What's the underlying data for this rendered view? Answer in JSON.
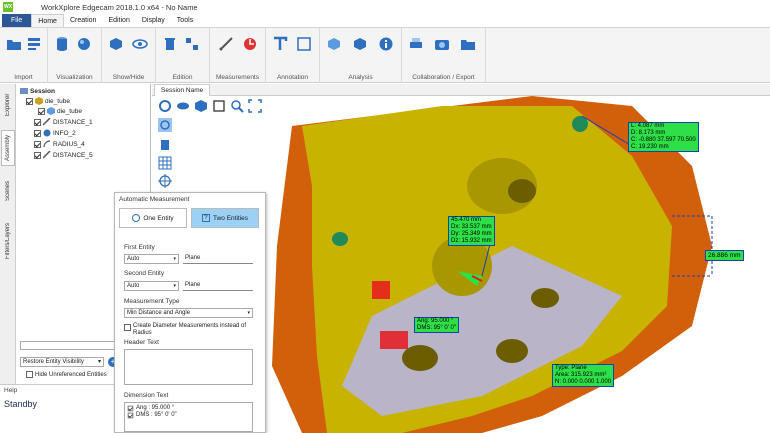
{
  "app": {
    "title": "WorkXplore Edgecam 2018.1.0 x64 - No Name",
    "logo_text": "WX"
  },
  "menu": {
    "items": [
      "File",
      "Home",
      "Creation",
      "Edition",
      "Display",
      "Tools"
    ]
  },
  "ribbon": {
    "groups": [
      "Import",
      "Visualization",
      "Show/Hide",
      "Edition",
      "Measurements",
      "Annotation",
      "Analysis",
      "Collaboration / Export"
    ]
  },
  "side_tabs": [
    "Explorer",
    "Assembly",
    "Scenes",
    "Filters/Layers"
  ],
  "tree": {
    "root": "Session",
    "items": [
      "die_tube",
      "die_tube",
      "DISTANCE_1",
      "INFO_2",
      "RADIUS_4",
      "DISTANCE_5"
    ]
  },
  "tree_footer": {
    "visibility_select": "Restore Entity Visibility",
    "hide_label": "Hide Unreferenced Entities"
  },
  "help": {
    "label": "Help",
    "status": "Standby"
  },
  "viewport": {
    "tab": "Session Name"
  },
  "measurements": {
    "box1": [
      "L: 4.087 mm",
      "D: 8.173 mm",
      "C: -0.880 37.597 70.500",
      "C: 19.230 mm"
    ],
    "box2": [
      "45.470 mm",
      "Dx: 33.537 mm",
      "Dy: 25.349 mm",
      "Dz: 15.932 mm"
    ],
    "box3": "26.886 mm",
    "box4": [
      "Ang: 95.000 °",
      "DMS: 95° 0' 0\""
    ],
    "box5": [
      "Type: Plane",
      "Area: 315.923 mm²",
      "N: 0.000 0.000 1.000"
    ]
  },
  "dialog": {
    "title": "Automatic Measurement",
    "tab_one": "One Entity",
    "tab_two": "Two Entities",
    "first_entity_label": "First Entity",
    "first_entity_mode": "Auto",
    "first_entity_value": "Plane",
    "second_entity_label": "Second Entity",
    "second_entity_mode": "Auto",
    "second_entity_value": "Plane",
    "measurement_type_label": "Measurement Type",
    "measurement_type": "Min Distance and Angle",
    "diameter_option": "Create Diameter Measurements instead of Radius",
    "header_text_label": "Header Text",
    "dimension_text_label": "Dimension Text",
    "dimension_lines": [
      "Ang : 95.000 °",
      "DMS : 95° 0' 0\""
    ]
  },
  "colors": {
    "accent": "#2b5797",
    "model_yellow": "#c8b400",
    "model_orange": "#d2600a",
    "plane_grey": "#b9b4c8",
    "measure_green": "#2ee048",
    "selection_red": "#e8171e"
  }
}
